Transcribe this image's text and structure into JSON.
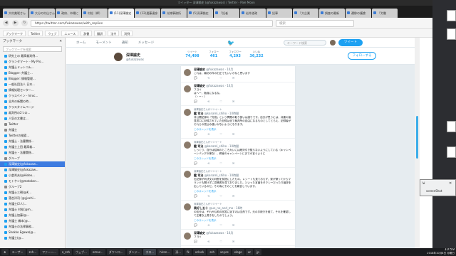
{
  "window": {
    "title": "ツイッター 深澤諭史 (@fukazawas) / Twitter - Pale Moon"
  },
  "tabs": [
    {
      "label": "大村美咲さん"
    },
    {
      "label": "大分の村山さん"
    },
    {
      "label": "政府、市場に"
    },
    {
      "label": "村松（師）"
    },
    {
      "label": "(11)深澤諭史"
    },
    {
      "label": "(12)遠藤達彦"
    },
    {
      "label": "光線事務所"
    },
    {
      "label": "(5)深澤諭史"
    },
    {
      "label": "「記者"
    },
    {
      "label": "岩井道政"
    },
    {
      "label": "記事"
    },
    {
      "label": "「大企業"
    },
    {
      "label": "調査の最新"
    },
    {
      "label": "遷移の議論"
    },
    {
      "label": "「労働"
    }
  ],
  "nav": {
    "back": "◀",
    "forward": "▶",
    "reload": "↻",
    "url": "https://twitter.com/fukazawas/with_replies",
    "search_placeholder": "検索"
  },
  "bookmarks_bar": [
    "ブックマーク",
    "Twitter",
    "ウェブ",
    "ニュース",
    "辞書",
    "翻訳",
    "法令",
    "判例"
  ],
  "sidebar": {
    "title": "ブックマーク",
    "close": "✕",
    "search_placeholder": "ブックマークを検索",
    "items": [
      {
        "label": "研究上の 最高裁判例...",
        "folder": false
      },
      {
        "label": "グランタマート - My Pro...",
        "folder": false
      },
      {
        "label": "弁護士ドットコム...",
        "folder": false
      },
      {
        "label": "Blogger: 弁護士...",
        "folder": false
      },
      {
        "label": "Blogger: 情報管理...",
        "folder": false
      },
      {
        "label": "一般社団法人 日本...",
        "folder": false
      },
      {
        "label": "情報処理センター...",
        "folder": false
      },
      {
        "label": "クラスペイン - hiroc...",
        "folder": false
      },
      {
        "label": "全共の新聞の時...",
        "folder": false
      },
      {
        "label": "クラスタイムページ",
        "folder": false
      },
      {
        "label": "裁判所の2つの...",
        "folder": false
      },
      {
        "label": "人気の文書は...",
        "folder": false
      },
      {
        "label": "Twitter",
        "folder": true
      },
      {
        "label": "弁護士",
        "folder": true
      },
      {
        "label": "Twitterの検索...",
        "folder": false
      },
      {
        "label": "弁護士・法曹関係...",
        "folder": false
      },
      {
        "label": "弁護士上田 最高裁...",
        "folder": false
      },
      {
        "label": "弁護士・法曹関係...",
        "folder": false
      },
      {
        "label": "グループ",
        "folder": true
      },
      {
        "label": "深澤諭史(@fukazaw...",
        "folder": false,
        "selected": true
      },
      {
        "label": "深澤諭史(@fukazaw...",
        "folder": false
      },
      {
        "label": "小倉秀夫(@Hideo...",
        "folder": false
      },
      {
        "label": "モトケン(@motoken...",
        "folder": false
      },
      {
        "label": "グループ2",
        "folder": true
      },
      {
        "label": "弁護士三朝(@K...",
        "folder": false
      },
      {
        "label": "落合洋司 (@yjochi...",
        "folder": false
      },
      {
        "label": "弁護士(2人)...",
        "folder": false
      },
      {
        "label": "弁護士 村松(@m...",
        "folder": false
      },
      {
        "label": "弁護士加藤(@...",
        "folder": false
      },
      {
        "label": "弁護士 橋本(@...",
        "folder": false
      },
      {
        "label": "弁護士の法律事務...",
        "folder": false
      },
      {
        "label": "Shokko Egawa(@...",
        "folder": false
      },
      {
        "label": "弁護士(@...",
        "folder": false
      }
    ]
  },
  "twitter": {
    "nav": [
      "ホーム",
      "モーメント",
      "通知",
      "メッセージ"
    ],
    "logo": "🐦",
    "search_placeholder": "キーワード検索",
    "tweet_button": "ツイート",
    "profile": {
      "name": "深澤諭史",
      "handle": "@fukazawas",
      "stats": [
        {
          "label": "ツイート",
          "value": "74,498"
        },
        {
          "label": "フォロー",
          "value": "461"
        },
        {
          "label": "フォロワー",
          "value": "4,293"
        },
        {
          "label": "いいね",
          "value": "36,232"
        }
      ],
      "follow_button": "フォローする"
    },
    "tweets": [
      {
        "retweet": "",
        "name": "深澤諭史",
        "handle": "@fukazawas · 10月",
        "text": "これは、最初の件の訂正でもいいかなと思います",
        "more": "",
        "short": true
      },
      {
        "retweet": "",
        "name": "深澤諭史",
        "handle": "@fukazawas · 10月",
        "text": "フヨイ\nはへー、勉強になるな。\n（・ー・）",
        "more": ""
      },
      {
        "retweet": "深澤諭史さんがリツイート",
        "name": "鑑 司法",
        "handle": "@kanami_shiho · 10時間",
        "text": "非公開記録の「完成」という問題の取り扱いは誤りです。自分が思うには、弁護の接見窓口に記録されていた記録は全て裁判所の自由になるものとしてとらえ、記録者がそれらの見込み違いがないようになります。",
        "more": "このスレッドを表示"
      },
      {
        "retweet": "深澤諭史さんがリツイート",
        "name": "鑑 司法",
        "handle": "@kanami_shiho · 10時間",
        "text": "しっくり、自分は結局のところ大いには絶対引き籠らないようにしている（キャンペーンバッグの様な）、教室のキャンペーンにまでの言うように",
        "more": "このスレッドを表示"
      },
      {
        "retweet": "深澤諭史さんがリツイート",
        "name": "鑑 司法",
        "handle": "@kanami_shiho · 10時間",
        "text": "右記録が判決文の判断を前提にしたもの。レシートも見ておらず、家が帰ってからマランドも開けずに見積書を見ておりました。といった言論をタクシーだったり論評を出しているのだ。その為にそのことを報告しています。",
        "more": "このスレッドを表示"
      },
      {
        "retweet": "深澤諭史さんがリツイート",
        "name": "奥好し五十",
        "handle": "@ue_no_and_mo · 16時",
        "text": "の処分は、それが以前の回答に返すのは当然です。元の手続きを経て、それを確認して正確な上書きをしたのでしょう。",
        "more": "このスレッドを表示"
      },
      {
        "retweet": "",
        "name": "深澤諭史",
        "handle": "@fukazawas · 10月",
        "text": "フヨイ",
        "more": ""
      }
    ]
  },
  "screenshot_popup": {
    "icon": "⇲",
    "close": "✕",
    "label": "screenShot"
  },
  "taskbar": {
    "items": [
      "❖",
      "ユーザー",
      "zsh...",
      "ファーー...",
      "a_zsh",
      "ウェブ...",
      "emac...",
      "ダウンロ...",
      "ダンジ...",
      "ホロ...",
      "hiron...",
      "深...",
      "fk",
      "xclock",
      "ssh",
      "xeyes",
      "xlogo",
      "xc",
      "jp"
    ],
    "time": "10:59",
    "date": "2018年10月8日 月曜日"
  }
}
